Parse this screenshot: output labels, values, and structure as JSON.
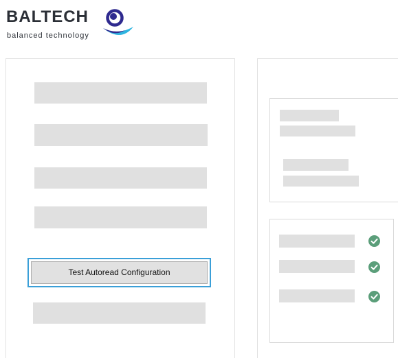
{
  "logo": {
    "wordmark": "BALTECH",
    "tagline": "balanced technology",
    "mark_icon": "baltech-logo-mark-icon",
    "colors": {
      "text": "#2b2f36",
      "mark_dark": "#2f2a8f",
      "mark_light": "#2fb5e0"
    }
  },
  "left_panel": {
    "placeholders_count_note": "",
    "test_button_label": "Test Autoread Configuration"
  },
  "right_panel": {
    "status_icon": "check-circle-icon"
  },
  "colors": {
    "placeholder": "#e0e0e0",
    "focus_ring": "#3a9fd8",
    "check_green": "#5b9e7a",
    "panel_border": "#e1e1e1"
  }
}
